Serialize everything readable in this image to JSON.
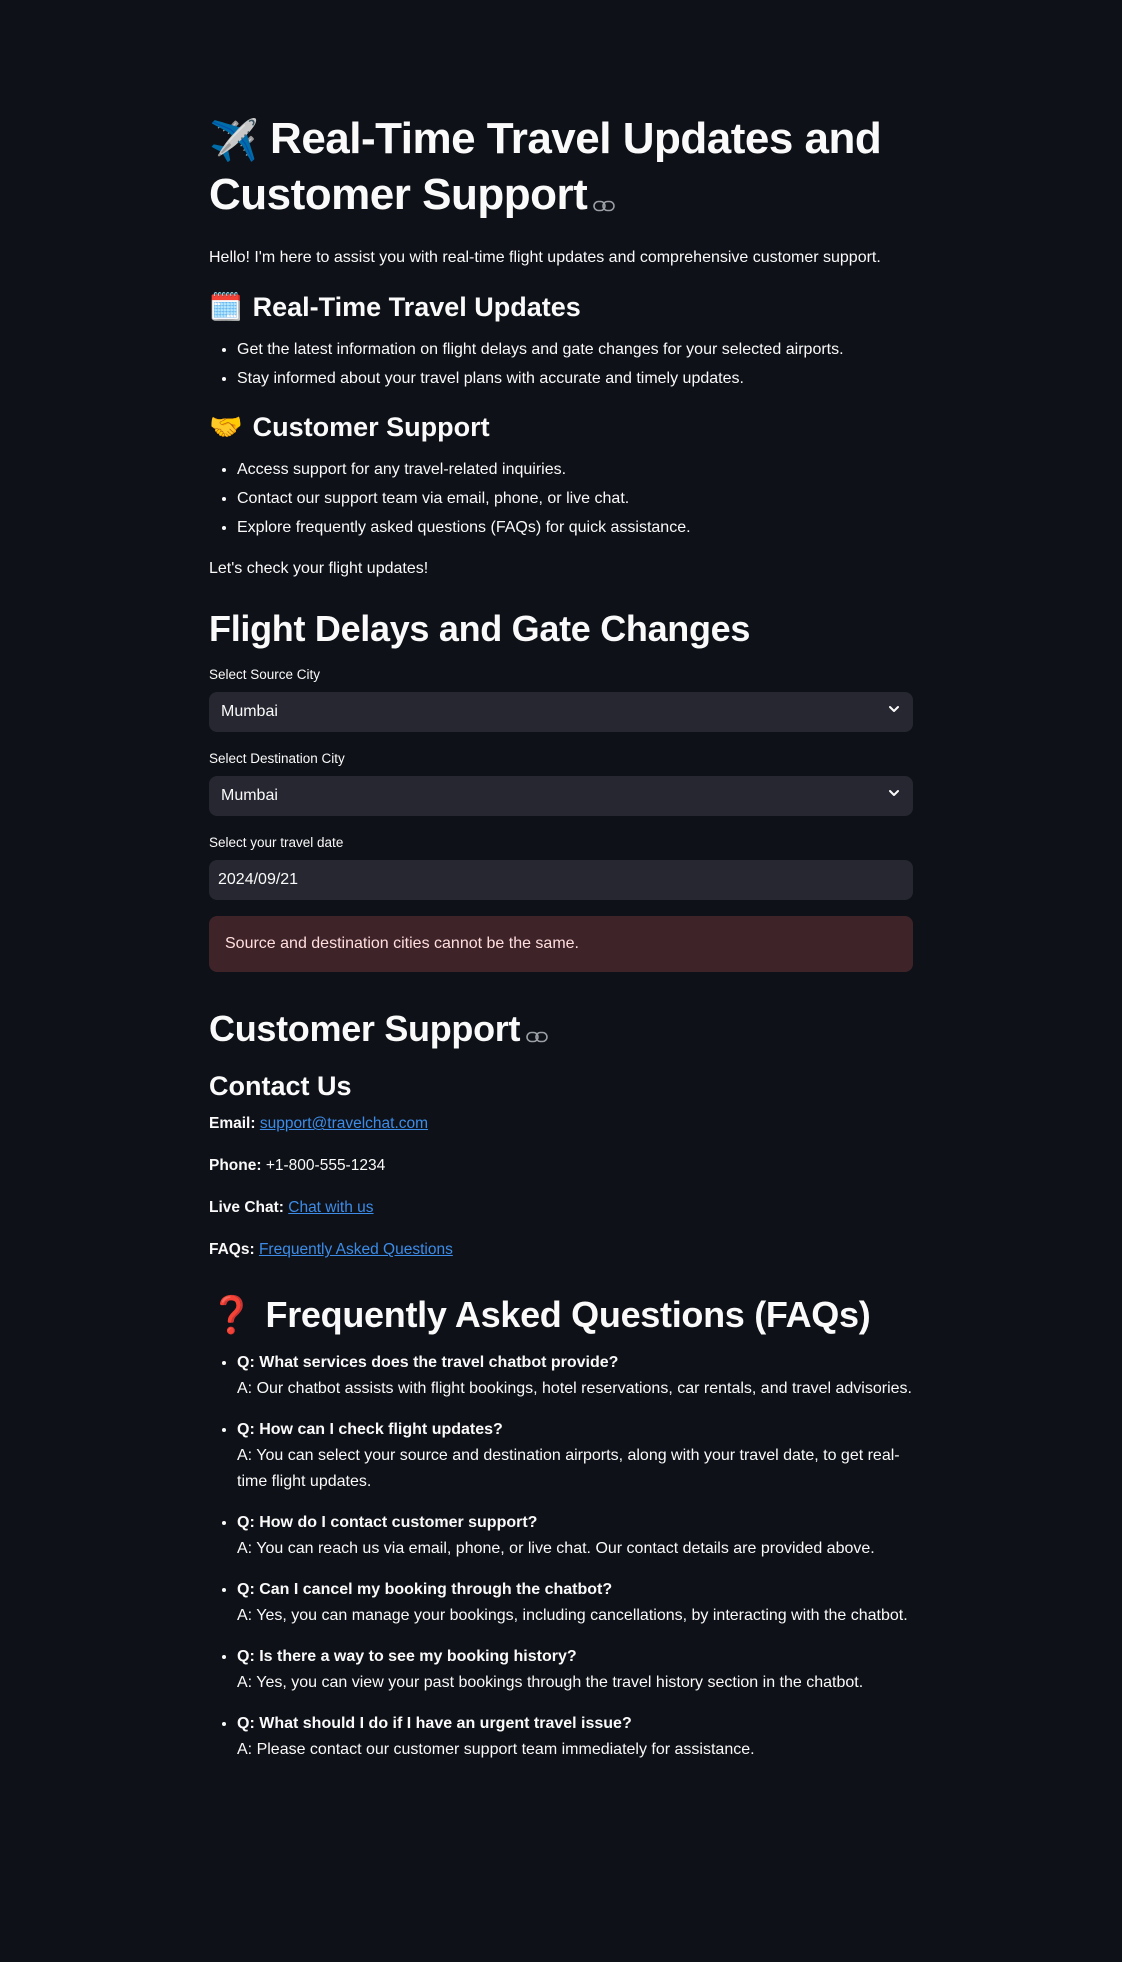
{
  "hero": {
    "emoji": "✈️",
    "title_line1": "Real-Time Travel Updates and",
    "title_line2": "Customer Support"
  },
  "intro": "Hello! I'm here to assist you with real-time flight updates and comprehensive customer support.",
  "updates_section": {
    "emoji": "🗓️",
    "heading": "Real-Time Travel Updates",
    "items": [
      "Get the latest information on flight delays and gate changes for your selected airports.",
      "Stay informed about your travel plans with accurate and timely updates."
    ]
  },
  "support_section": {
    "emoji": "🤝",
    "heading": "Customer Support",
    "items": [
      "Access support for any travel-related inquiries.",
      "Contact our support team via email, phone, or live chat.",
      "Explore frequently asked questions (FAQs) for quick assistance."
    ]
  },
  "cta": "Let's check your flight updates!",
  "flight": {
    "heading": "Flight Delays and Gate Changes",
    "source_label": "Select Source City",
    "source_value": "Mumbai",
    "dest_label": "Select Destination City",
    "dest_value": "Mumbai",
    "date_label": "Select your travel date",
    "date_value": "2024/09/21",
    "error": "Source and destination cities cannot be the same."
  },
  "customer_support": {
    "heading": "Customer Support",
    "contact_heading": "Contact Us",
    "email_label": "Email:",
    "email_value": "support@travelchat.com",
    "phone_label": "Phone:",
    "phone_value": "+1-800-555-1234",
    "chat_label": "Live Chat:",
    "chat_value": "Chat with us",
    "faqs_label": "FAQs:",
    "faqs_value": "Frequently Asked Questions"
  },
  "faq": {
    "emoji": "❓",
    "heading": "Frequently Asked Questions (FAQs)",
    "items": [
      {
        "q": "Q: What services does the travel chatbot provide?",
        "a": "A: Our chatbot assists with flight bookings, hotel reservations, car rentals, and travel advisories."
      },
      {
        "q": "Q: How can I check flight updates?",
        "a": "A: You can select your source and destination airports, along with your travel date, to get real-time flight updates."
      },
      {
        "q": "Q: How do I contact customer support?",
        "a": "A: You can reach us via email, phone, or live chat. Our contact details are provided above."
      },
      {
        "q": "Q: Can I cancel my booking through the chatbot?",
        "a": "A: Yes, you can manage your bookings, including cancellations, by interacting with the chatbot."
      },
      {
        "q": "Q: Is there a way to see my booking history?",
        "a": "A: Yes, you can view your past bookings through the travel history section in the chatbot."
      },
      {
        "q": "Q: What should I do if I have an urgent travel issue?",
        "a": "A: Please contact our customer support team immediately for assistance."
      }
    ]
  },
  "colors": {
    "background": "#0e1117",
    "input_bg": "#262730",
    "error_bg": "#3e2328",
    "link": "#3d8ce8"
  }
}
